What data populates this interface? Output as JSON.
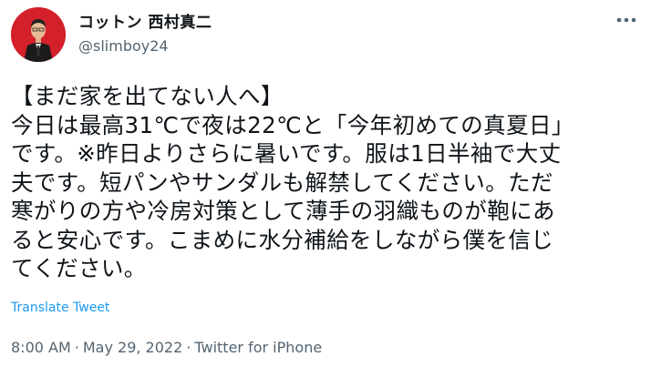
{
  "user": {
    "display_name": "コットン 西村真二",
    "handle": "@slimboy24"
  },
  "tweet": {
    "text": "【まだ家を出てない人へ】\n今日は最高31℃で夜は22℃と「今年初めての真夏日」\nです。※昨日よりさらに暑いです。服は1日半袖で大丈\n夫です。短パンやサンダルも解禁してください。ただ\n寒がりの方や冷房対策として薄手の羽織ものが鞄にあ\nると安心です。こまめに水分補給をしながら僕を信じ\nてください。",
    "translate_label": "Translate Tweet",
    "time": "8:00 AM",
    "date": "May 29, 2022",
    "source": "Twitter for iPhone",
    "separator": "·"
  },
  "icons": {
    "more": "more-options-icon",
    "avatar": "profile-photo"
  },
  "colors": {
    "link": "#1d9bf0",
    "secondary_text": "#536471",
    "avatar_bg": "#d4202a"
  }
}
